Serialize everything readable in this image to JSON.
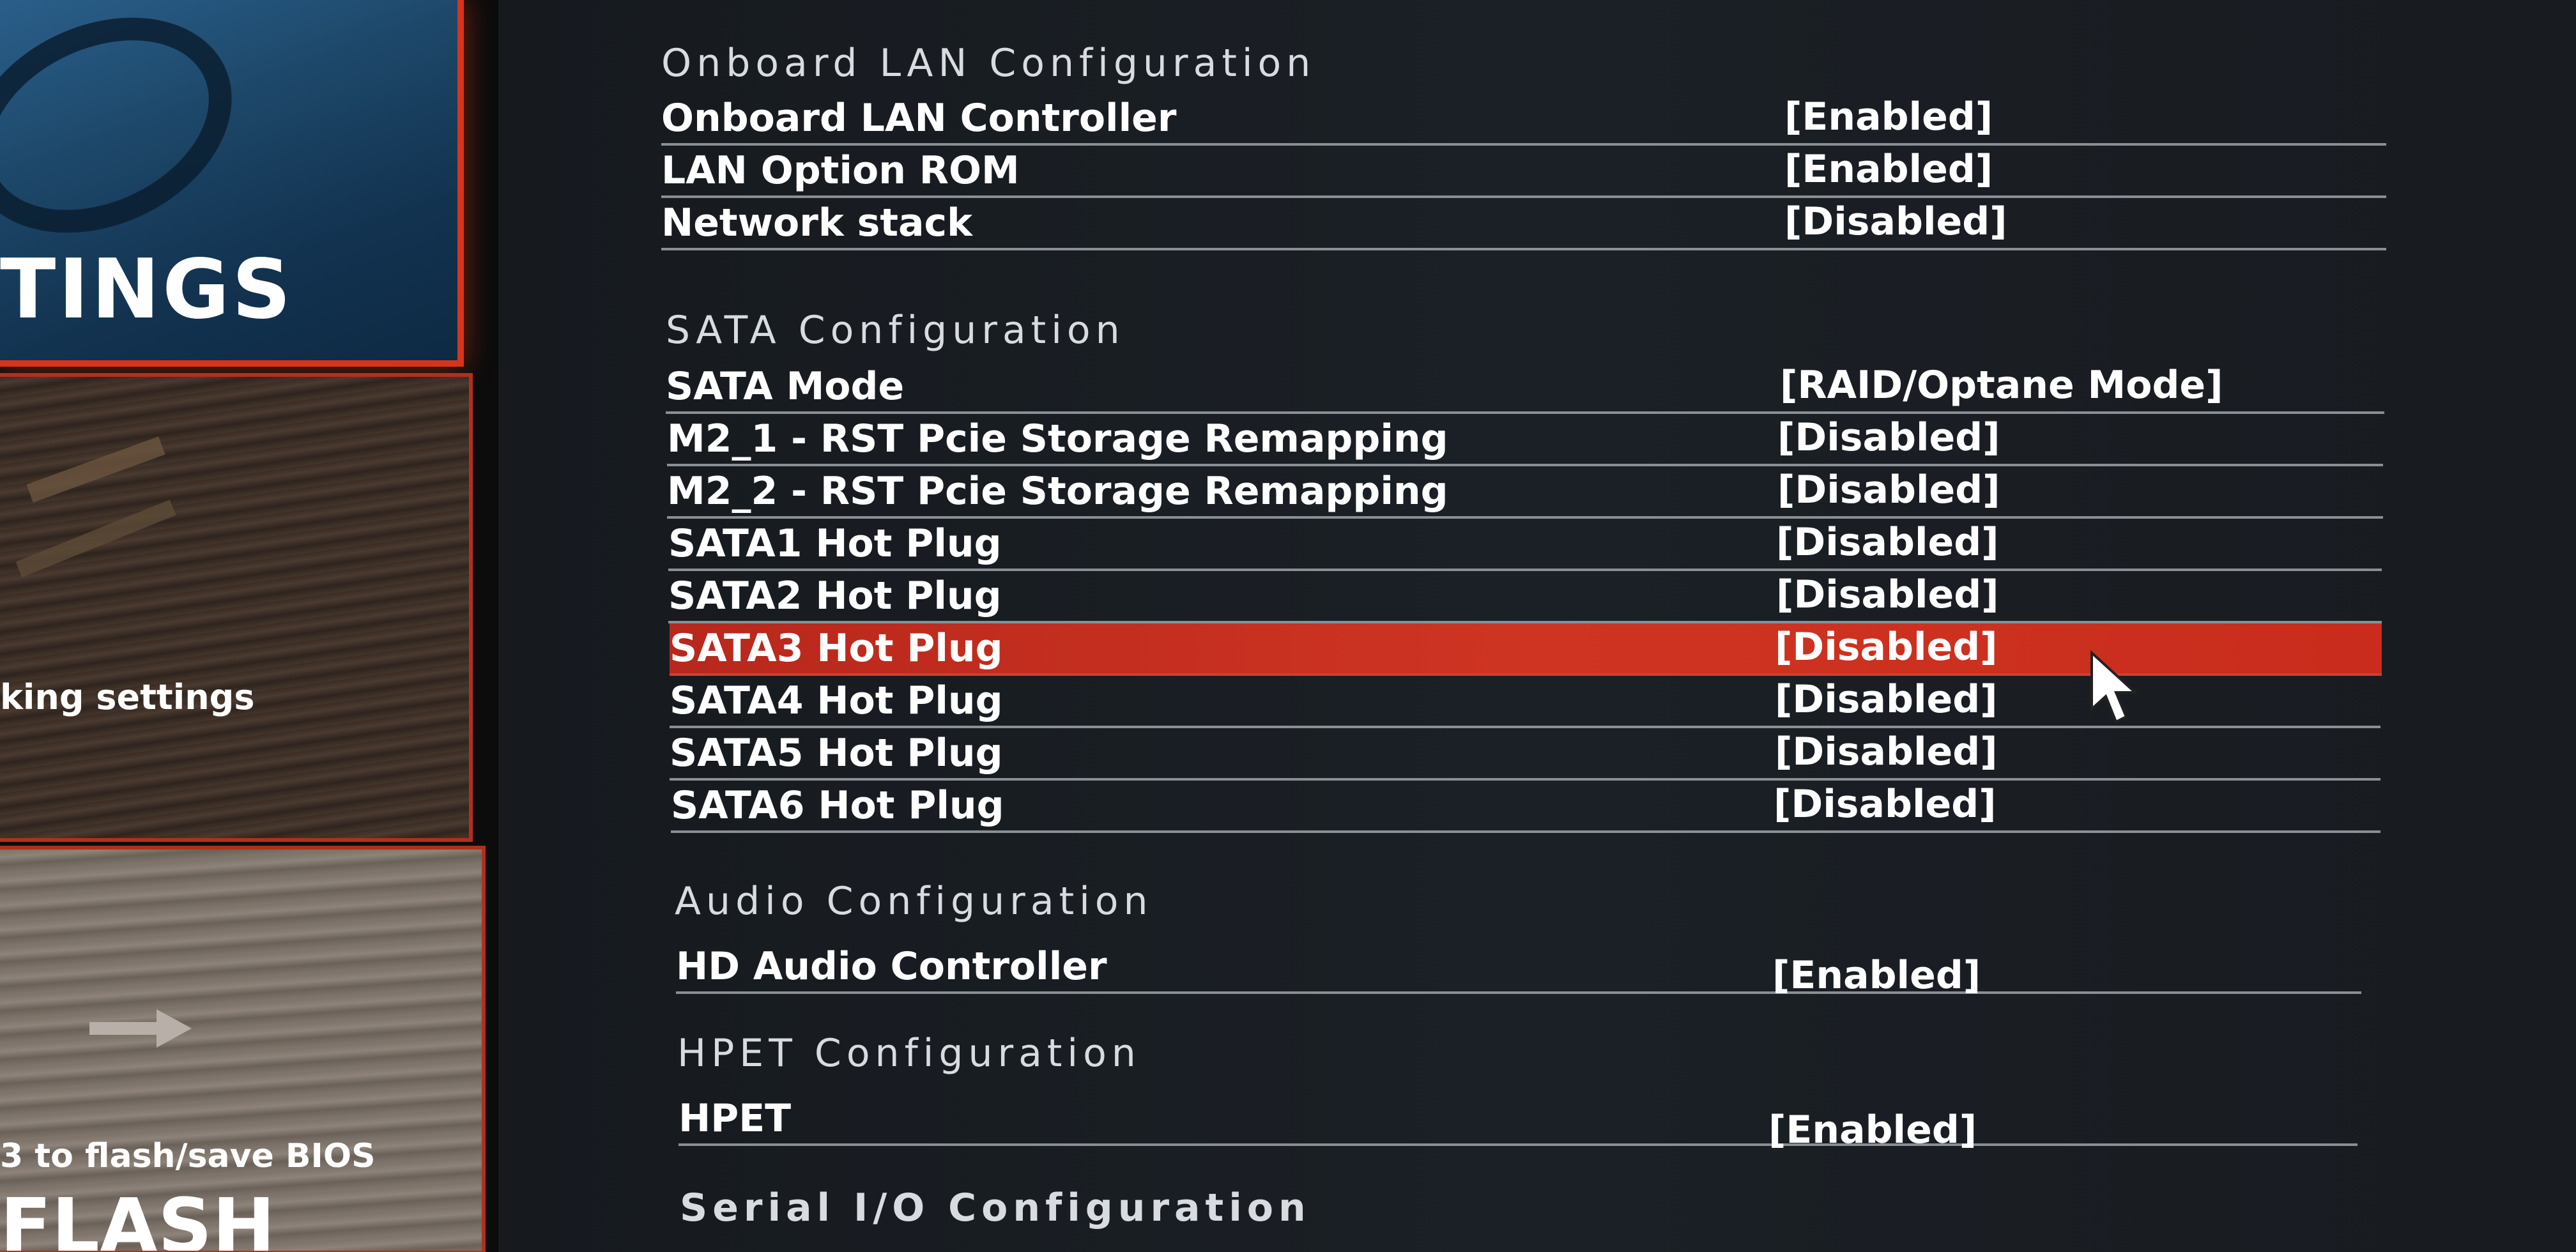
{
  "sidebar": {
    "settings_tile": {
      "label": "TINGS"
    },
    "oc_tile": {
      "subtitle": "king settings"
    },
    "flash_tile": {
      "subtitle": "3 to flash/save BIOS",
      "label": "FLASH"
    }
  },
  "sections": [
    {
      "title": "Onboard LAN Configuration",
      "items": [
        {
          "label": "Onboard LAN Controller",
          "value": "[Enabled]"
        },
        {
          "label": "LAN Option ROM",
          "value": "[Enabled]"
        },
        {
          "label": "Network stack",
          "value": "[Disabled]"
        }
      ]
    },
    {
      "title": "SATA Configuration",
      "items": [
        {
          "label": "SATA Mode",
          "value": "[RAID/Optane Mode]"
        },
        {
          "label": "M2_1 - RST Pcie Storage Remapping",
          "value": "[Disabled]"
        },
        {
          "label": "M2_2 - RST Pcie Storage Remapping",
          "value": "[Disabled]"
        },
        {
          "label": "SATA1 Hot Plug",
          "value": "[Disabled]"
        },
        {
          "label": "SATA2 Hot Plug",
          "value": "[Disabled]"
        },
        {
          "label": "SATA3 Hot Plug",
          "value": "[Disabled]",
          "selected": true
        },
        {
          "label": "SATA4 Hot Plug",
          "value": "[Disabled]"
        },
        {
          "label": "SATA5 Hot Plug",
          "value": "[Disabled]"
        },
        {
          "label": "SATA6 Hot Plug",
          "value": "[Disabled]"
        }
      ]
    },
    {
      "title": "Audio Configuration",
      "items": [
        {
          "label": "HD Audio Controller",
          "value": "[Enabled]"
        }
      ]
    },
    {
      "title": "HPET Configuration",
      "items": [
        {
          "label": "HPET",
          "value": "[Enabled]"
        }
      ]
    },
    {
      "title": "Serial I/O Configuration",
      "items": []
    }
  ],
  "colors": {
    "accent": "#cf3422",
    "background": "#1b2026",
    "text": "#ffffff"
  },
  "icons": {
    "cursor": "mouse-pointer-icon",
    "flash_arrow": "arrow-right-icon"
  }
}
